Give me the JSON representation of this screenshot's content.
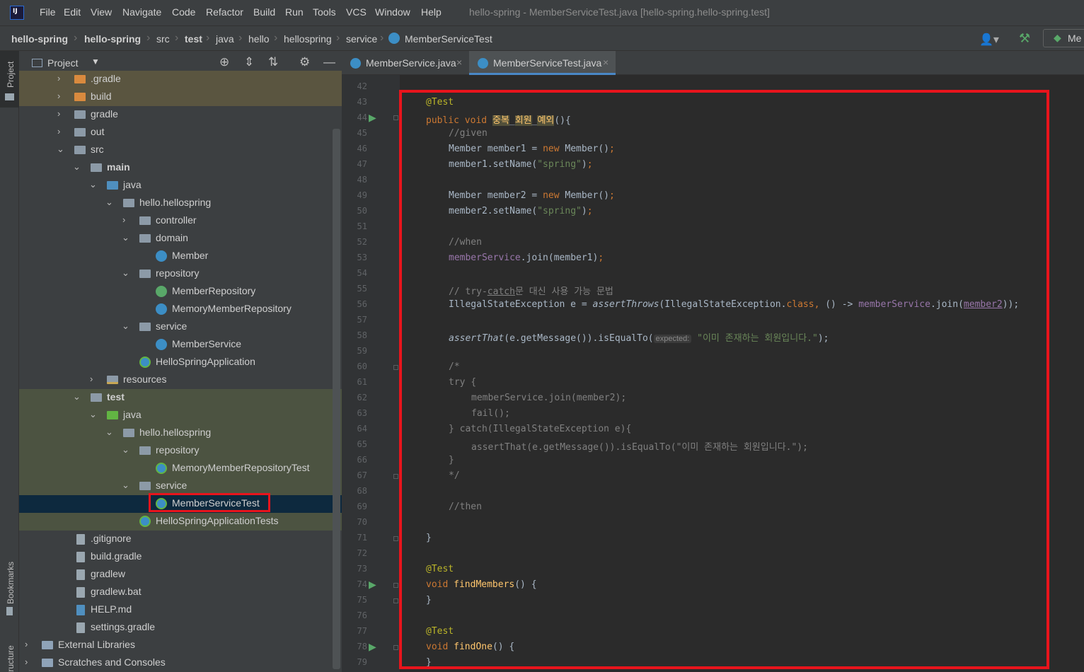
{
  "menubar": {
    "items": [
      "File",
      "Edit",
      "View",
      "Navigate",
      "Code",
      "Refactor",
      "Build",
      "Run",
      "Tools",
      "VCS",
      "Window",
      "Help"
    ],
    "window_title": "hello-spring - MemberServiceTest.java [hello-spring.hello-spring.test]"
  },
  "breadcrumb": {
    "items": [
      "hello-spring",
      "hello-spring",
      "src",
      "test",
      "java",
      "hello",
      "hellospring",
      "service",
      "MemberServiceTest"
    ],
    "run_config": "Me"
  },
  "stripe": {
    "project": "Project",
    "bookmarks": "Bookmarks",
    "structure": "Structure"
  },
  "project_panel": {
    "title": "Project",
    "tree": [
      ".gradle",
      "build",
      "gradle",
      "out",
      "src",
      "main",
      "java",
      "hello.hellospring",
      "controller",
      "domain",
      "Member",
      "repository",
      "MemberRepository",
      "MemoryMemberRepository",
      "service",
      "MemberService",
      "HelloSpringApplication",
      "resources",
      "test",
      "java",
      "hello.hellospring",
      "repository",
      "MemoryMemberRepositoryTest",
      "service",
      "MemberServiceTest",
      "HelloSpringApplicationTests",
      ".gitignore",
      "build.gradle",
      "gradlew",
      "gradlew.bat",
      "HELP.md",
      "settings.gradle",
      "External Libraries",
      "Scratches and Consoles"
    ]
  },
  "editor": {
    "tabs": [
      "MemberService.java",
      "MemberServiceTest.java"
    ],
    "active_tab": "MemberServiceTest.java",
    "line_numbers": [
      "42",
      "43",
      "44",
      "45",
      "46",
      "47",
      "48",
      "49",
      "50",
      "51",
      "52",
      "53",
      "54",
      "55",
      "56",
      "57",
      "58",
      "59",
      "60",
      "61",
      "62",
      "63",
      "64",
      "65",
      "66",
      "67",
      "68",
      "69",
      "70",
      "71",
      "72",
      "73",
      "74",
      "75",
      "76",
      "77",
      "78",
      "79"
    ],
    "code": {
      "l43_annotation": "@Test",
      "l44_public": "public",
      "l44_void": "void",
      "l44_n1": "중복",
      "l44_n2": "회원",
      "l44_n3": "예외",
      "l45": "//given",
      "l46_a": "Member member1 = ",
      "l46_new": "new",
      "l46_b": " Member()",
      "l47_a": "member1.setName(",
      "l47_str": "\"spring\"",
      "l49_a": "Member member2 = ",
      "l49_new": "new",
      "l49_b": " Member()",
      "l50_a": "member2.setName(",
      "l50_str": "\"spring\"",
      "l52": "//when",
      "l53_field": "memberService",
      "l53_rest": ".join(member1)",
      "l55_a": "// try-",
      "l55_b": "catch",
      "l55_c": "문 대신 사용 가능 문법",
      "l56_a": "IllegalStateException e = ",
      "l56_method": "assertThrows",
      "l56_b": "(IllegalStateException.",
      "l56_class": "class",
      "l56_c": " () -> ",
      "l56_field": "memberService",
      "l56_d": ".join(",
      "l56_var": "member2",
      "l56_e": "));",
      "l58_method": "assertThat",
      "l58_a": "(e.getMessage()).isEqualTo(",
      "l58_hint": "expected:",
      "l58_str": "\"이미 존재하는 회원입니다.\"",
      "l58_b": ");",
      "l60": "/*",
      "l61": "try {",
      "l62": "memberService.join(member2);",
      "l63": "fail();",
      "l64": "} catch(IllegalStateException e){",
      "l65": "assertThat(e.getMessage()).isEqualTo(\"이미 존재하는 회원입니다.\");",
      "l66": "}",
      "l67": "*/",
      "l69": "//then",
      "l71": "}",
      "l73": "@Test",
      "l74_void": "void",
      "l74_name": "findMembers",
      "l74_rest": "() {",
      "l75": "}",
      "l77": "@Test",
      "l78_void": "void",
      "l78_name": "findOne",
      "l78_rest": "() {",
      "l79": "}"
    }
  },
  "colors": {
    "highlight_box": "#e8141c",
    "selection": "#0d293e",
    "test_folder_bg": "#4c5341",
    "excluded_folder_bg": "#5a5540"
  }
}
